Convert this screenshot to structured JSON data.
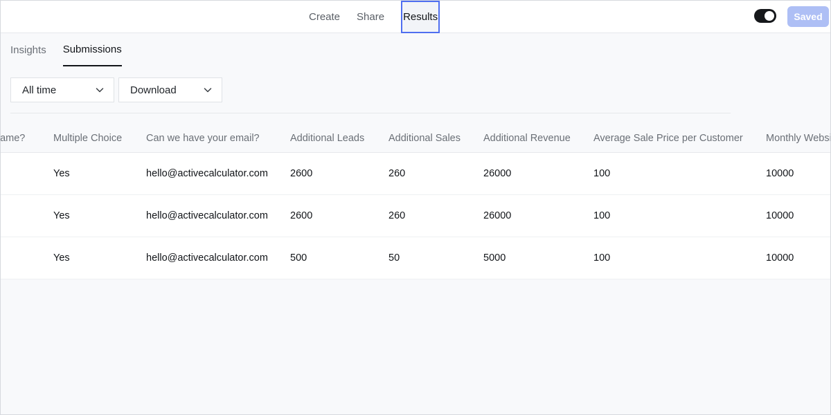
{
  "topnav": {
    "create": "Create",
    "share": "Share",
    "results": "Results"
  },
  "saved_label": "Saved",
  "subtabs": {
    "insights": "Insights",
    "submissions": "Submissions"
  },
  "filters": {
    "time": "All time",
    "download": "Download"
  },
  "table": {
    "headers": [
      "name?",
      "Multiple Choice",
      "Can we have your email?",
      "Additional Leads",
      "Additional Sales",
      "Additional Revenue",
      "Average Sale Price per Customer",
      "Monthly Website Visitors"
    ],
    "rows": [
      [
        "",
        "Yes",
        "hello@activecalculator.com",
        "2600",
        "260",
        "26000",
        "100",
        "10000"
      ],
      [
        "",
        "Yes",
        "hello@activecalculator.com",
        "2600",
        "260",
        "26000",
        "100",
        "10000"
      ],
      [
        "",
        "Yes",
        "hello@activecalculator.com",
        "500",
        "50",
        "5000",
        "100",
        "10000"
      ]
    ]
  },
  "colors": {
    "accent_focus": "#4f6ef0",
    "saved_button": "#aebff5",
    "toggle_on": "#16181b"
  },
  "icons": {
    "dropdown": "chevron-down-icon"
  }
}
